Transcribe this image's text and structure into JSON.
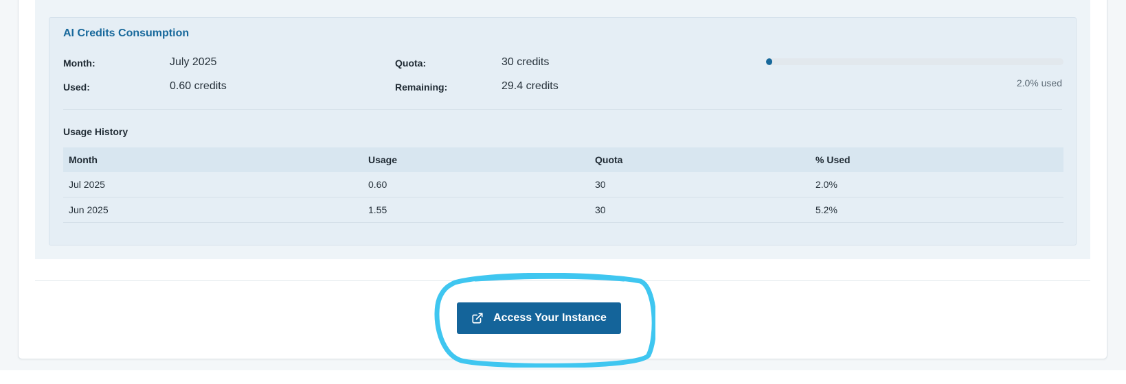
{
  "credits": {
    "title": "AI Credits Consumption",
    "month_label": "Month:",
    "month_value": "July 2025",
    "quota_label": "Quota:",
    "quota_value": "30 credits",
    "used_label": "Used:",
    "used_value": "0.60 credits",
    "remaining_label": "Remaining:",
    "remaining_value": "29.4 credits",
    "progress_fraction": 0.02,
    "progress_text": "2.0% used"
  },
  "history": {
    "title": "Usage History",
    "headers": [
      "Month",
      "Usage",
      "Quota",
      "% Used"
    ],
    "rows": [
      [
        "Jul 2025",
        "0.60",
        "30",
        "2.0%"
      ],
      [
        "Jun 2025",
        "1.55",
        "30",
        "5.2%"
      ]
    ]
  },
  "footer": {
    "access_button_label": "Access Your Instance",
    "button_icon": "external-link-icon"
  },
  "colors": {
    "accent": "#17689b",
    "button_bg": "#14649a",
    "annotation_ring": "#3fc6f0"
  }
}
